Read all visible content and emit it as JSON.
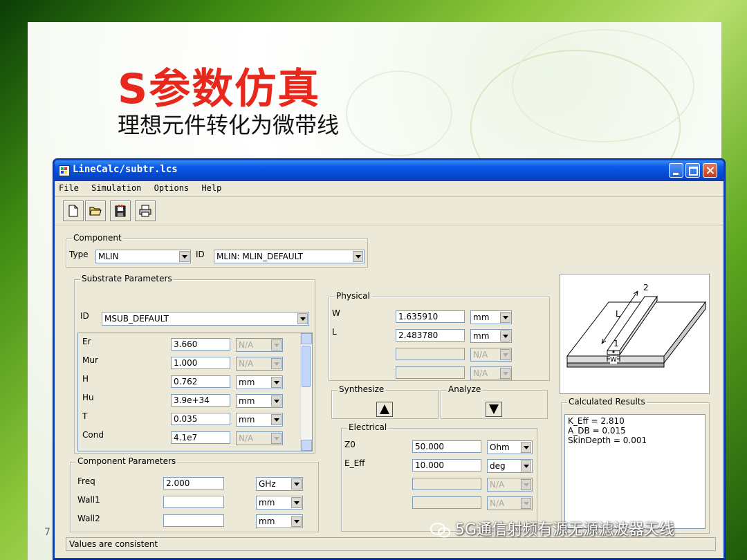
{
  "slide": {
    "title": "S参数仿真",
    "subtitle": "理想元件转化为微带线",
    "page_number": "7",
    "watermark": "5G通信射频有源无源滤波器天线"
  },
  "window": {
    "title": "LineCalc/subtr.lcs",
    "menu": [
      "File",
      "Simulation",
      "Options",
      "Help"
    ],
    "toolbar": [
      "new-file-icon",
      "open-folder-icon",
      "save-icon",
      "print-icon"
    ]
  },
  "component": {
    "group_label": "Component",
    "type_label": "Type",
    "type_value": "MLIN",
    "id_label": "ID",
    "id_value": "MLIN: MLIN_DEFAULT"
  },
  "substrate": {
    "group_label": "Substrate Parameters",
    "id_label": "ID",
    "id_value": "MSUB_DEFAULT",
    "rows": [
      {
        "name": "Er",
        "value": "3.660",
        "unit": "N/A",
        "unit_disabled": true
      },
      {
        "name": "Mur",
        "value": "1.000",
        "unit": "N/A",
        "unit_disabled": true
      },
      {
        "name": "H",
        "value": "0.762",
        "unit": "mm",
        "unit_disabled": false
      },
      {
        "name": "Hu",
        "value": "3.9e+34",
        "unit": "mm",
        "unit_disabled": false
      },
      {
        "name": "T",
        "value": "0.035",
        "unit": "mm",
        "unit_disabled": false
      },
      {
        "name": "Cond",
        "value": "4.1e7",
        "unit": "N/A",
        "unit_disabled": true
      }
    ]
  },
  "component_params": {
    "group_label": "Component Parameters",
    "rows": [
      {
        "name": "Freq",
        "value": "2.000",
        "unit": "GHz"
      },
      {
        "name": "Wall1",
        "value": "",
        "unit": "mm"
      },
      {
        "name": "Wall2",
        "value": "",
        "unit": "mm"
      }
    ]
  },
  "physical": {
    "group_label": "Physical",
    "rows": [
      {
        "name": "W",
        "value": "1.635910",
        "unit": "mm",
        "disabled": false
      },
      {
        "name": "L",
        "value": "2.483780",
        "unit": "mm",
        "disabled": false
      },
      {
        "name": "",
        "value": "",
        "unit": "N/A",
        "disabled": true
      },
      {
        "name": "",
        "value": "",
        "unit": "N/A",
        "disabled": true
      }
    ]
  },
  "synthesize": {
    "label": "Synthesize"
  },
  "analyze": {
    "label": "Analyze"
  },
  "electrical": {
    "group_label": "Electrical",
    "rows": [
      {
        "name": "Z0",
        "value": "50.000",
        "unit": "Ohm",
        "disabled": false
      },
      {
        "name": "E_Eff",
        "value": "10.000",
        "unit": "deg",
        "disabled": false
      },
      {
        "name": "",
        "value": "",
        "unit": "N/A",
        "disabled": true
      },
      {
        "name": "",
        "value": "",
        "unit": "N/A",
        "disabled": true
      }
    ]
  },
  "diagram": {
    "port2": "2",
    "port1": "1",
    "length_label": "L",
    "width_label": "W"
  },
  "results": {
    "group_label": "Calculated Results",
    "lines": [
      "K_Eff = 2.810",
      "A_DB = 0.015",
      "SkinDepth = 0.001"
    ]
  },
  "status": {
    "text": "Values are consistent"
  },
  "colors": {
    "title_red": "#e8281c",
    "window_blue": "#0a5ce8",
    "window_face": "#ece9d8"
  }
}
